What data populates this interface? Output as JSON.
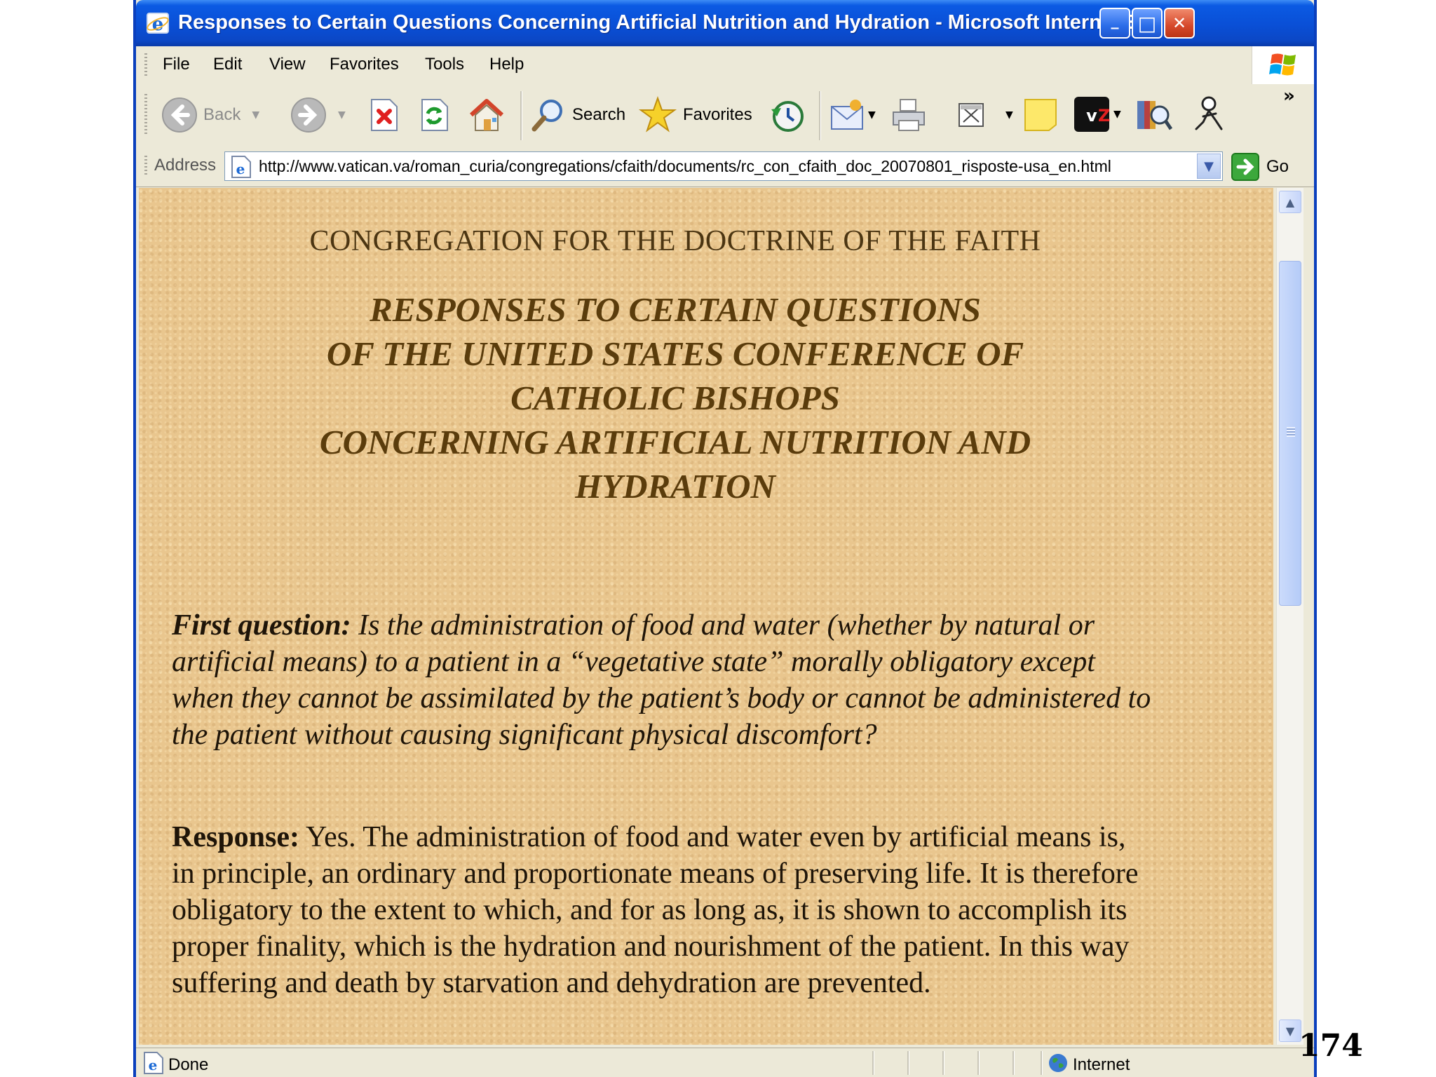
{
  "window": {
    "title": "Responses to Certain Questions Concerning Artificial Nutrition and Hydration - Microsoft Internet Expl...",
    "controls": {
      "minimize": "_",
      "maximize": "□",
      "close": "✕"
    }
  },
  "menu": {
    "items": [
      "File",
      "Edit",
      "View",
      "Favorites",
      "Tools",
      "Help"
    ]
  },
  "toolbar": {
    "back_label": "Back",
    "search_label": "Search",
    "favorites_label": "Favorites",
    "overflow": "»"
  },
  "address": {
    "label": "Address",
    "url": "http://www.vatican.va/roman_curia/congregations/cfaith/documents/rc_con_cfaith_doc_20070801_risposte-usa_en.html",
    "go_label": "Go"
  },
  "document": {
    "congregation": "CONGREGATION FOR THE DOCTRINE OF THE FAITH",
    "title_lines": [
      "RESPONSES TO CERTAIN QUESTIONS",
      "OF THE UNITED STATES CONFERENCE OF",
      "CATHOLIC BISHOPS",
      "CONCERNING ARTIFICIAL NUTRITION AND",
      "HYDRATION"
    ],
    "question_label": "First question:",
    "question_text": " Is the administration of food and water (whether by natural or artificial means) to a patient in a “vegetative state” morally obligatory except when they cannot be assimilated by the patient’s body or cannot be administered to the patient without causing significant physical discomfort?",
    "response_label": "Response:",
    "response_text": " Yes. The administration of food and water even by artificial means is, in principle, an ordinary and proportionate means of preserving life. It is therefore obligatory to the extent to which, and for as long as, it is shown to accomplish its proper finality, which is the hydration and nourishment of the patient. In this way suffering and death by starvation and dehydration are prevented."
  },
  "status": {
    "text": "Done",
    "zone": "Internet"
  },
  "slide_number": "174",
  "colors": {
    "titlebar": "#0b4fd6",
    "page_background": "#e9c68e",
    "title_text": "#5a3c0c"
  }
}
